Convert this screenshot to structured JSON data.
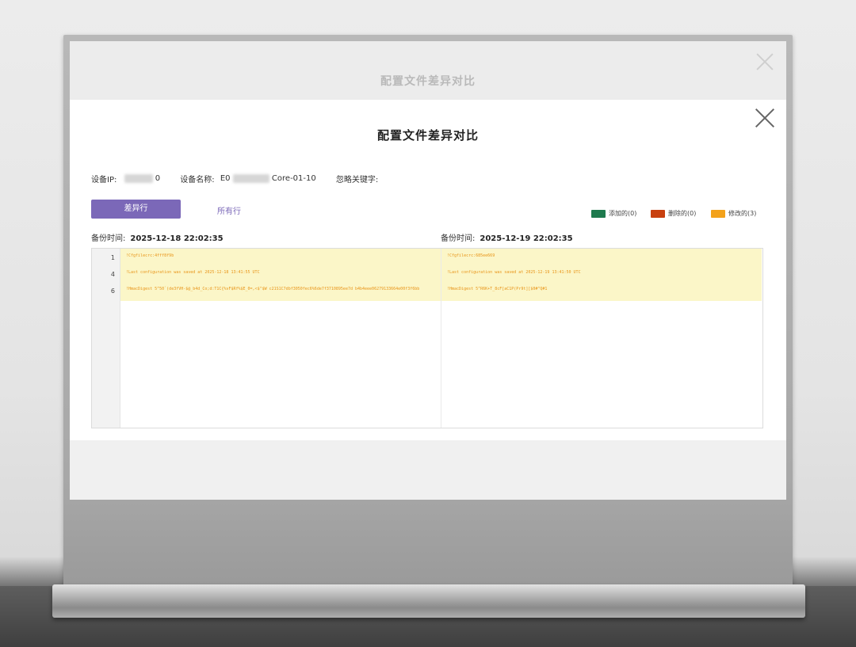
{
  "background_title": "配置文件差异对比",
  "modal": {
    "title": "配置文件差异对比",
    "device_ip_label": "设备IP:",
    "device_ip_suffix": "0",
    "device_name_label": "设备名称:",
    "device_name_prefix": "E0",
    "device_name_suffix": "Core-01-10",
    "ignore_keyword_label": "忽略关键字:"
  },
  "filters": {
    "diff_lines_label": "差异行",
    "all_lines_label": "所有行"
  },
  "legend": [
    {
      "label": "添加的(0)",
      "color": "#1e7a4e"
    },
    {
      "label": "删除的(0)",
      "color": "#c8400f"
    },
    {
      "label": "修改的(3)",
      "color": "#f3a21b"
    }
  ],
  "left": {
    "backup_time_label": "备份时间:",
    "backup_time": "2025-12-18 22:02:35",
    "lines": [
      {
        "no": "1",
        "text": "!Cfgfilecrc:4fff8f9b"
      },
      {
        "no": "4",
        "text": "!Last configuration was saved at 2025-12-18 13:41:55 UTC"
      },
      {
        "no": "6",
        "text": "!HmacDigest 5^50`(de3fVH-$@_b4d_Co;d:T1C{%vF$Rf%$E_0=,<$^$W c21S1C7dbf3050fec6%6de7f3710895ee7d b4b4eee06279133664e00f3f6bb"
      }
    ]
  },
  "right": {
    "backup_time_label": "备份时间:",
    "backup_time": "2025-12-19 22:02:35",
    "lines": [
      {
        "text": "!Cfgfilecrc:685ee669"
      },
      {
        "text": "!Last configuration was saved at 2025-12-19 13:41:50 UTC"
      },
      {
        "text": "!HmacDigest 5^R6K+T_8cF[aC1P(Pr9t][$0#^Q#1"
      }
    ]
  }
}
